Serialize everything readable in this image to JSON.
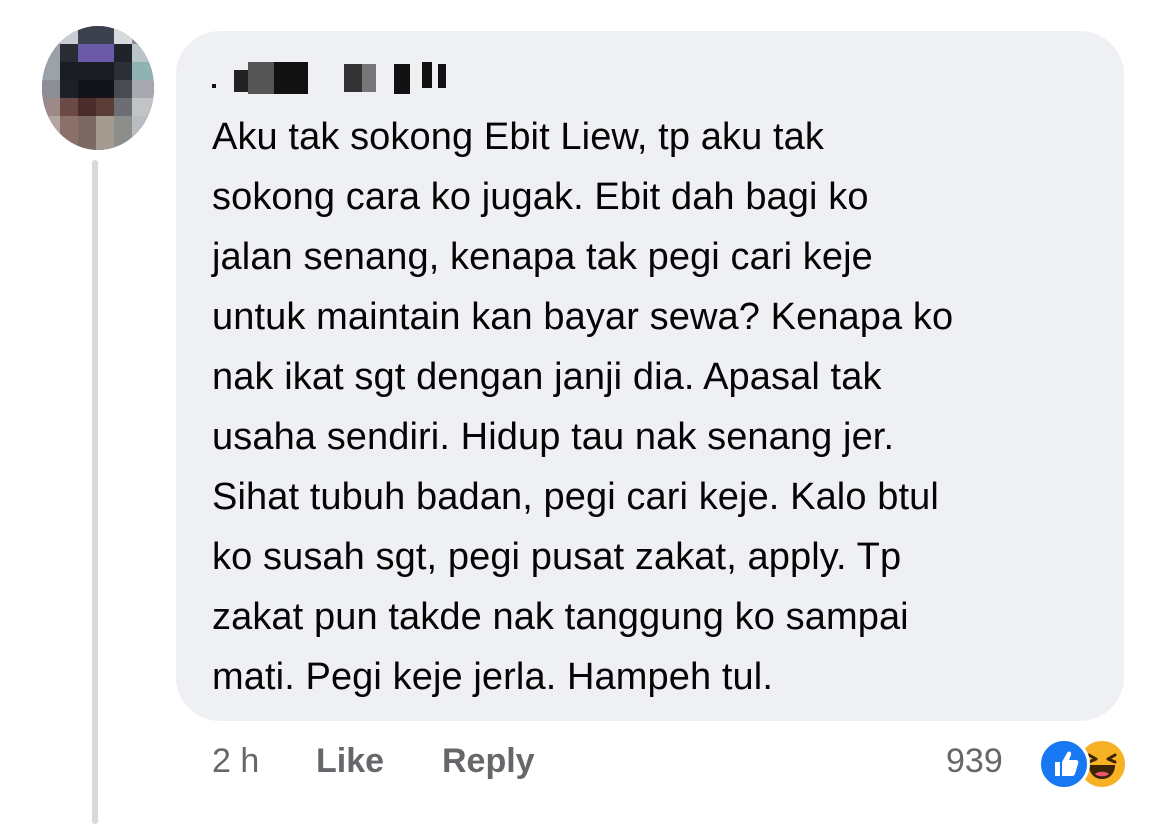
{
  "comment": {
    "author_name": "",
    "text": "Aku tak sokong Ebit Liew, tp aku tak\nsokong cara ko jugak. Ebit dah bagi ko\njalan senang, kenapa tak pegi cari keje\nuntuk maintain kan bayar sewa? Kenapa ko\nnak ikat sgt dengan janji dia. Apasal tak\nusaha sendiri. Hidup tau nak senang jer.\nSihat tubuh badan, pegi cari keje. Kalo btul\nko susah sgt, pegi pusat zakat, apply. Tp\nzakat pun takde nak tanggung ko sampai\nmati. Pegi keje jerla. Hampeh tul."
  },
  "footer": {
    "time": "2 h",
    "like_label": "Like",
    "reply_label": "Reply",
    "reaction_count": "939",
    "reaction_icons": [
      "like-icon",
      "haha-icon"
    ]
  },
  "colors": {
    "bubble": "#eff0f3",
    "text": "#050505",
    "meta": "#65676b",
    "like_blue": "#1877f2",
    "haha_yellow": "#f7b125",
    "thread_line": "#d7d9dd"
  }
}
